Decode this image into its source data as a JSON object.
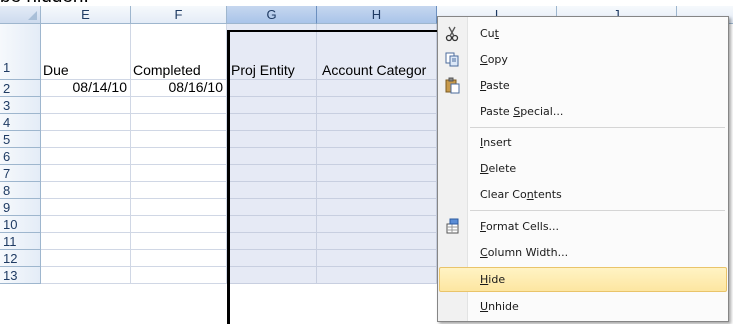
{
  "top_text": "be hidden.",
  "columns": [
    {
      "letter": "E",
      "selected": false
    },
    {
      "letter": "F",
      "selected": false
    },
    {
      "letter": "G",
      "selected": true
    },
    {
      "letter": "H",
      "selected": true
    },
    {
      "letter": "I",
      "selected": false
    },
    {
      "letter": "J",
      "selected": false
    }
  ],
  "rows": [
    "1",
    "2",
    "3",
    "4",
    "5",
    "6",
    "7",
    "8",
    "9",
    "10",
    "11",
    "12",
    "13"
  ],
  "cells": {
    "e1": "Due",
    "f1": "Completed",
    "g1": "Proj Entity",
    "h1": "Account Categor",
    "e2": "08/14/10",
    "f2": "08/16/10"
  },
  "menu": {
    "cut": {
      "pre": "Cu",
      "u": "t",
      "post": ""
    },
    "copy": {
      "pre": "",
      "u": "C",
      "post": "opy"
    },
    "paste": {
      "pre": "",
      "u": "P",
      "post": "aste"
    },
    "paste_special": {
      "pre": "Paste ",
      "u": "S",
      "post": "pecial..."
    },
    "insert": {
      "pre": "",
      "u": "I",
      "post": "nsert"
    },
    "delete": {
      "pre": "",
      "u": "D",
      "post": "elete"
    },
    "clear_contents": {
      "pre": "Clear Co",
      "u": "n",
      "post": "tents"
    },
    "format_cells": {
      "pre": "",
      "u": "F",
      "post": "ormat Cells..."
    },
    "column_width": {
      "pre": "",
      "u": "C",
      "post": "olumn Width..."
    },
    "hide": {
      "pre": "",
      "u": "H",
      "post": "ide"
    },
    "unhide": {
      "pre": "",
      "u": "U",
      "post": "nhide"
    }
  },
  "icons": {
    "cut": "scissors-icon",
    "copy": "copy-icon",
    "paste": "paste-icon",
    "format_cells": "format-cells-icon"
  },
  "colors": {
    "selection": "#e6eaf5",
    "highlight": "#fde6a1"
  }
}
